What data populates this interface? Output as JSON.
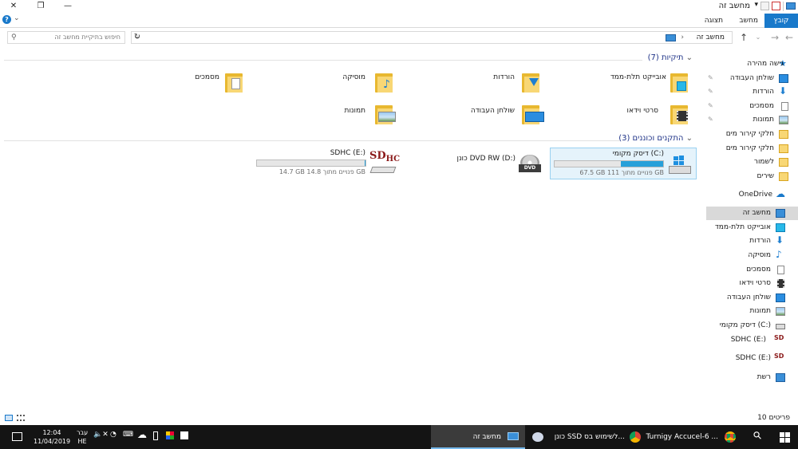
{
  "window": {
    "title": "מחשב זה",
    "close_glyph": "✕",
    "maximize_glyph": "❐",
    "minimize_glyph": "—",
    "chevron_glyph": "⌄",
    "help_glyph": "?"
  },
  "ribbon": {
    "tabs": [
      {
        "label": "קובץ",
        "active": true
      },
      {
        "label": "מחשב",
        "active": false
      },
      {
        "label": "תצוגה",
        "active": false
      }
    ]
  },
  "address": {
    "path": "מחשב זה",
    "search_placeholder": "חיפוש בתיקיית מחשב זה"
  },
  "folders_group": {
    "title": "תיקיות (7)",
    "items": [
      {
        "label": "אובייקט תלת-ממד",
        "icon": "3d-objects-icon"
      },
      {
        "label": "הורדות",
        "icon": "downloads-icon"
      },
      {
        "label": "מוסיקה",
        "icon": "music-icon"
      },
      {
        "label": "מסמכים",
        "icon": "documents-icon"
      },
      {
        "label": "סרטי וידאו",
        "icon": "videos-icon"
      },
      {
        "label": "שולחן העבודה",
        "icon": "desktop-icon"
      },
      {
        "label": "תמונות",
        "icon": "pictures-icon"
      }
    ]
  },
  "devices_group": {
    "title": "התקנים וכוננים (3)",
    "drives": [
      {
        "label": "דיסק מקומי (C:)",
        "free_text": "67.5 GB פנויים מתוך 111 GB",
        "used_fraction": 0.39
      },
      {
        "label": "כונן DVD RW (D:)",
        "free_text": ""
      },
      {
        "label": "SDHC (E:)",
        "free_text": "14.7 GB פנויים מתוך 14.8 GB",
        "used_fraction": 0.01
      }
    ]
  },
  "nav": {
    "items": [
      {
        "label": "גישה מהירה",
        "pinned": false
      },
      {
        "label": "שולחן העבודה",
        "pinned": true
      },
      {
        "label": "הורדות",
        "pinned": true
      },
      {
        "label": "מסמכים",
        "pinned": true
      },
      {
        "label": "תמונות",
        "pinned": true
      },
      {
        "label": "חלקי קירור מים",
        "pinned": false
      },
      {
        "label": "חלקי קירור מים",
        "pinned": false
      },
      {
        "label": "לשמור",
        "pinned": false
      },
      {
        "label": "שירים",
        "pinned": false
      },
      {
        "label": "OneDrive",
        "pinned": false
      },
      {
        "label": "מחשב זה",
        "pinned": false,
        "selected": true
      },
      {
        "label": "אובייקט תלת-ממד",
        "pinned": false
      },
      {
        "label": "הורדות",
        "pinned": false
      },
      {
        "label": "מוסיקה",
        "pinned": false
      },
      {
        "label": "מסמכים",
        "pinned": false
      },
      {
        "label": "סרטי וידאו",
        "pinned": false
      },
      {
        "label": "שולחן העבודה",
        "pinned": false
      },
      {
        "label": "תמונות",
        "pinned": false
      },
      {
        "label": "דיסק מקומי (C:)",
        "pinned": false
      },
      {
        "label": "SDHC (E:)",
        "pinned": false
      },
      {
        "label": "SDHC (E:)",
        "pinned": false
      },
      {
        "label": "רשת",
        "pinned": false
      }
    ],
    "pin_glyph": "✎"
  },
  "status": {
    "items_count": "10 פריטים"
  },
  "taskbar": {
    "windows": [
      {
        "label": "Turnigy Accucel-6 ...",
        "active": false
      },
      {
        "label": "כונן SSD לשימוש בס...",
        "active": false
      },
      {
        "label": "מחשב זה",
        "active": true
      }
    ],
    "clock_time": "12:04",
    "clock_date": "11/04/2019",
    "lang_top": "עבר",
    "lang_bottom": "HE",
    "search_glyph": "⚲",
    "volume_glyph": "🔈✕"
  },
  "colors": {
    "accent": "#1979ca",
    "folder": "#f8d775",
    "drive_fill": "#26a0da",
    "header_text": "#1e3287"
  }
}
